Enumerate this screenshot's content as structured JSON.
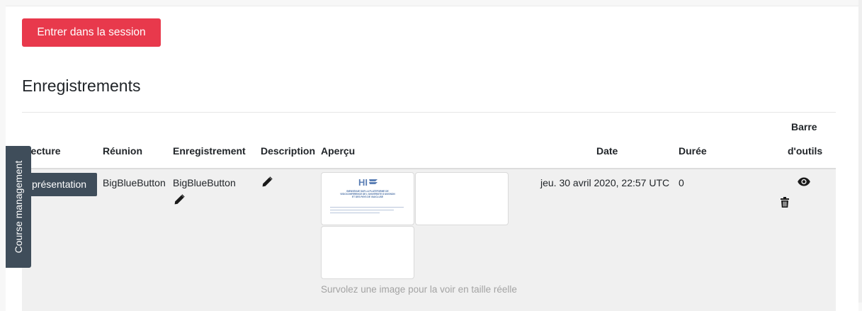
{
  "actions": {
    "enter_session": "Entrer dans la session"
  },
  "recordings": {
    "title": "Enregistrements",
    "columns": {
      "playback": "Lecture",
      "meeting": "Réunion",
      "recording": "Enregistrement",
      "description": "Description",
      "preview": "Aperçu",
      "date": "Date",
      "duration": "Durée",
      "toolbar_line1": "Barre",
      "toolbar_line2": "d'outils"
    },
    "rows": [
      {
        "playback_button": "présentation",
        "meeting": "BigBlueButton",
        "recording": "BigBlueButton",
        "date": "jeu. 30 avril 2020, 22:57 UTC",
        "duration": "0",
        "thumbnail_text": {
          "line1": "BIENVENUE SUR LA PLATEFORME DE",
          "line2": "VISIOCONFERENCE DE L'UNIVERSITE D'AVIGNON",
          "line3": "ET DES PAYS DE VAUCLUSE"
        }
      }
    ],
    "preview_hint": "Survolez une image pour la voir en taille réelle"
  },
  "sidebar": {
    "course_management": "Course management"
  },
  "colors": {
    "primary": "#e8394c",
    "drawer": "#3f4d5a",
    "row_bg": "#f0f0f0"
  },
  "icons": {
    "description_edit": "pencil-icon",
    "recording_edit": "pencil-icon",
    "view": "eye-icon",
    "delete": "trash-icon"
  }
}
